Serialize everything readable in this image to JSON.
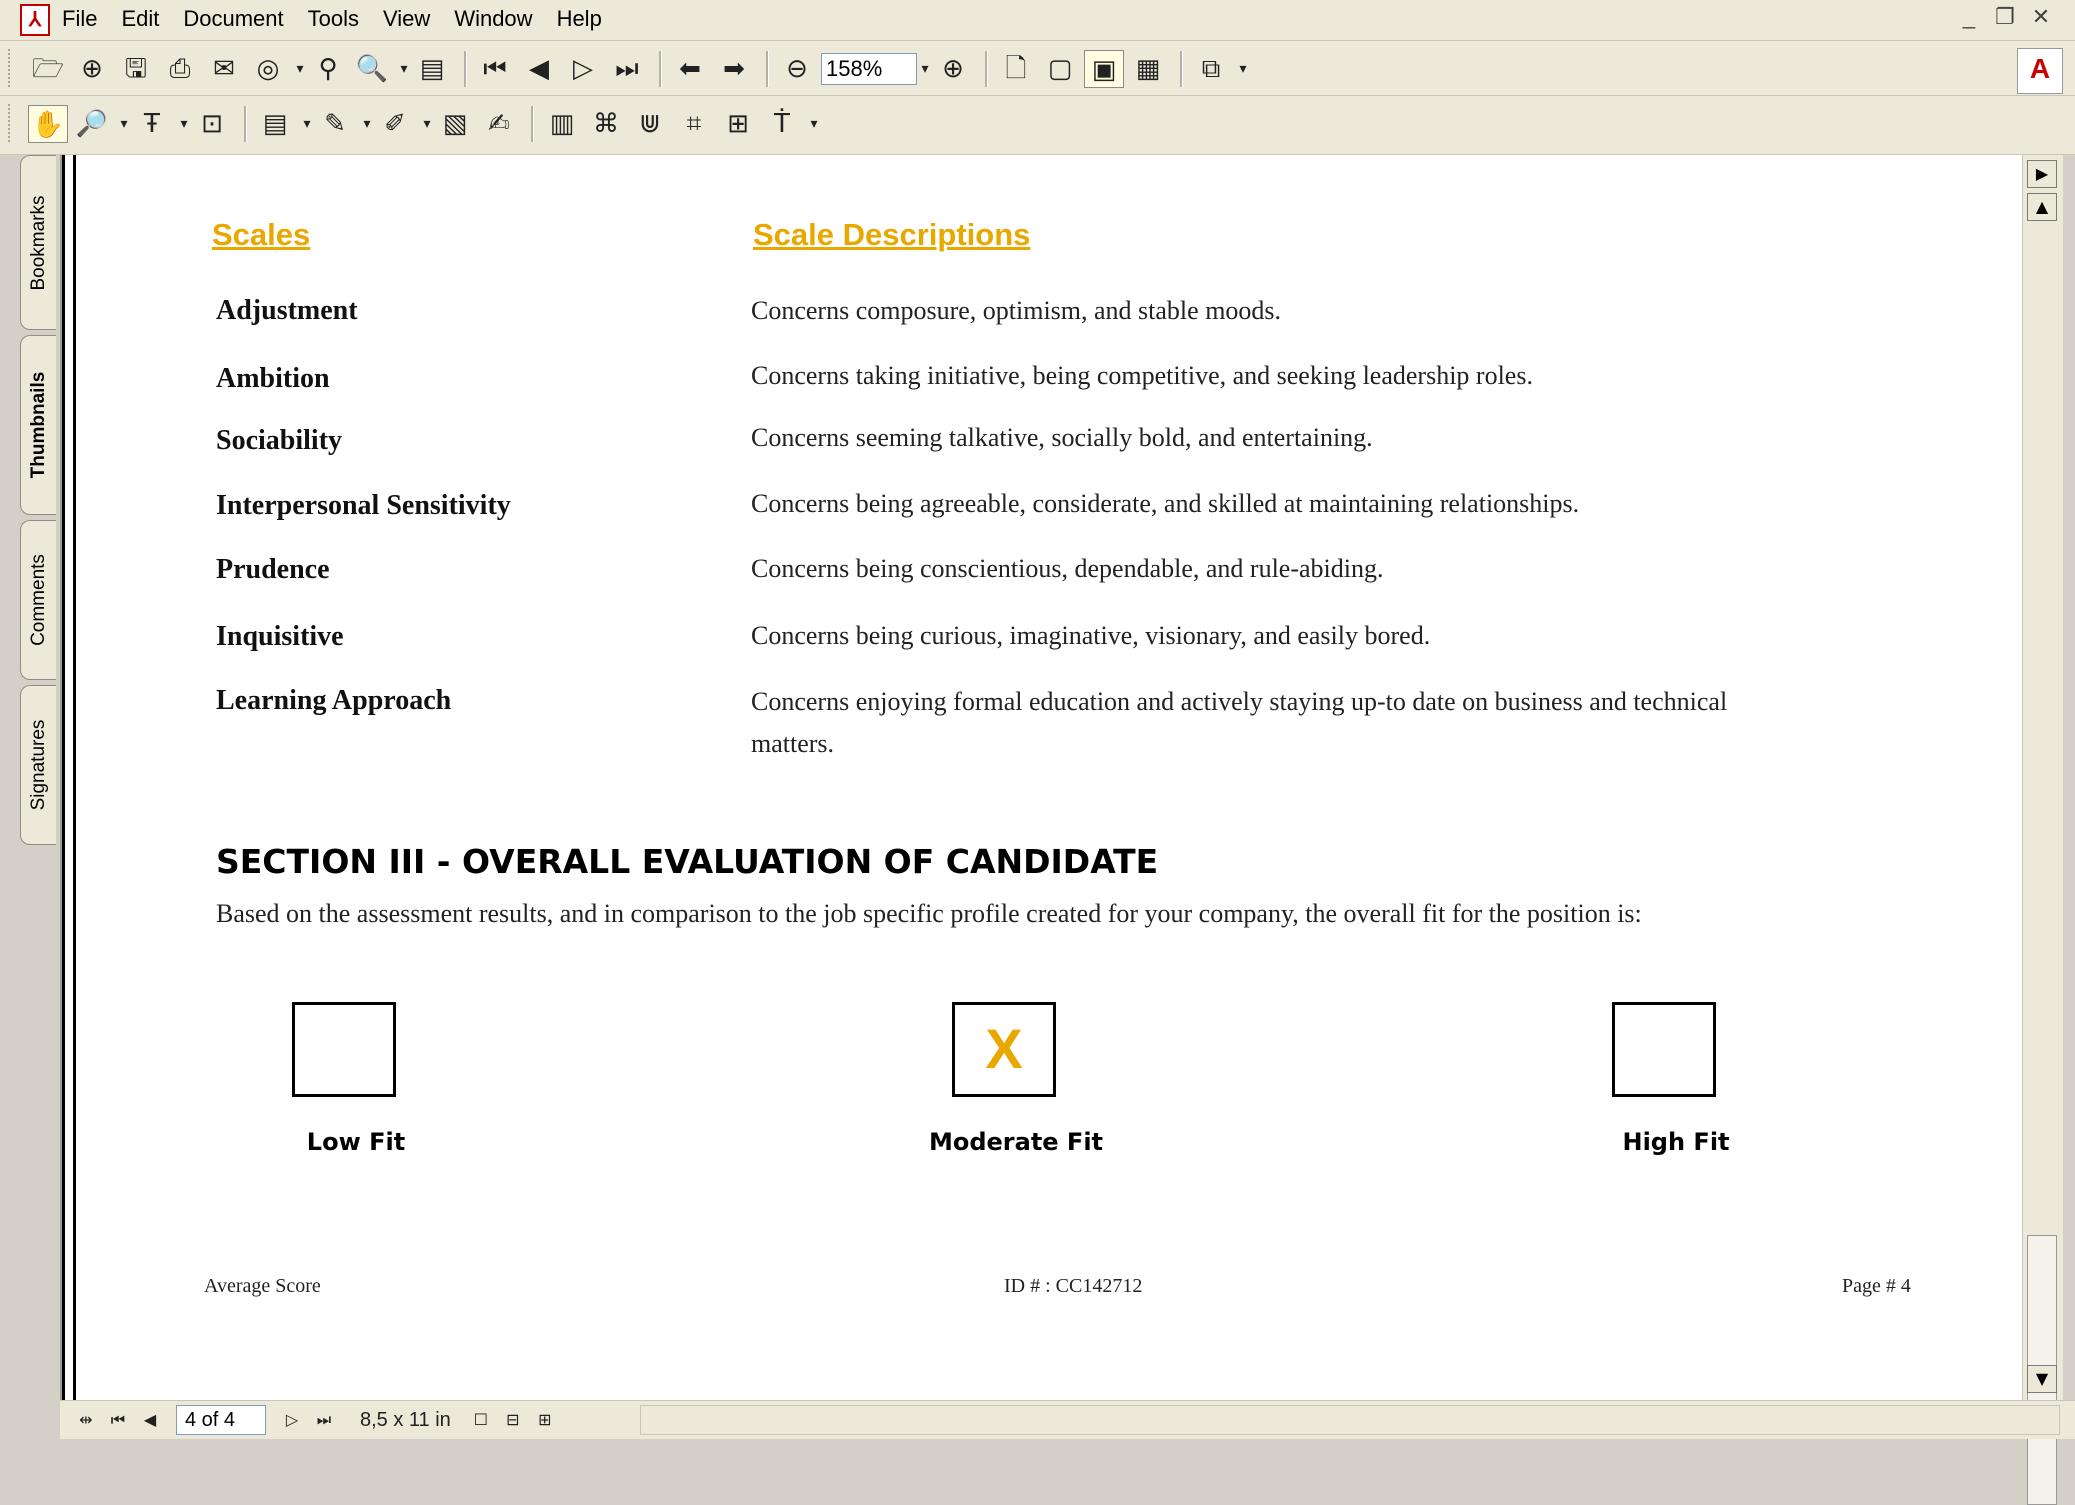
{
  "menubar": {
    "app_icon": "acrobat-pdf-icon",
    "items": [
      "File",
      "Edit",
      "Document",
      "Tools",
      "View",
      "Window",
      "Help"
    ],
    "window_controls": [
      "_",
      "❐",
      "✕"
    ]
  },
  "toolbar": {
    "zoom_value": "158%",
    "adobe_logo": "A"
  },
  "nav_tabs": [
    "Bookmarks",
    "Thumbnails",
    "Comments",
    "Signatures"
  ],
  "document": {
    "col_scales": "Scales",
    "col_descriptions": "Scale Descriptions",
    "rows": [
      {
        "name": "Adjustment",
        "desc": "Concerns composure, optimism, and stable moods."
      },
      {
        "name": "Ambition",
        "desc": "Concerns taking initiative, being competitive, and seeking leadership roles."
      },
      {
        "name": "Sociability",
        "desc": "Concerns seeming talkative, socially bold, and entertaining."
      },
      {
        "name": "Interpersonal Sensitivity",
        "desc": "Concerns being agreeable, considerate, and skilled at maintaining relationships."
      },
      {
        "name": "Prudence",
        "desc": "Concerns being conscientious, dependable, and rule-abiding."
      },
      {
        "name": "Inquisitive",
        "desc": "Concerns being curious, imaginative, visionary, and easily bored."
      },
      {
        "name": "Learning Approach",
        "desc": "Concerns enjoying formal education and actively staying up-to date on business and technical matters."
      }
    ],
    "section_title": "SECTION III - OVERALL EVALUATION OF CANDIDATE",
    "section_text": "Based on the assessment results, and in comparison to the job specific profile created for your company, the overall fit for the position is:",
    "fit_options": [
      {
        "label": "Low Fit",
        "mark": ""
      },
      {
        "label": "Moderate Fit",
        "mark": "X"
      },
      {
        "label": "High Fit",
        "mark": ""
      }
    ],
    "footer": {
      "left": "Average Score",
      "center": "ID # : CC142712",
      "right": "Page # 4"
    },
    "accent_color": "#e8a800"
  },
  "statusbar": {
    "page_indicator": "4 of 4",
    "page_size": "8,5 x 11 in"
  }
}
